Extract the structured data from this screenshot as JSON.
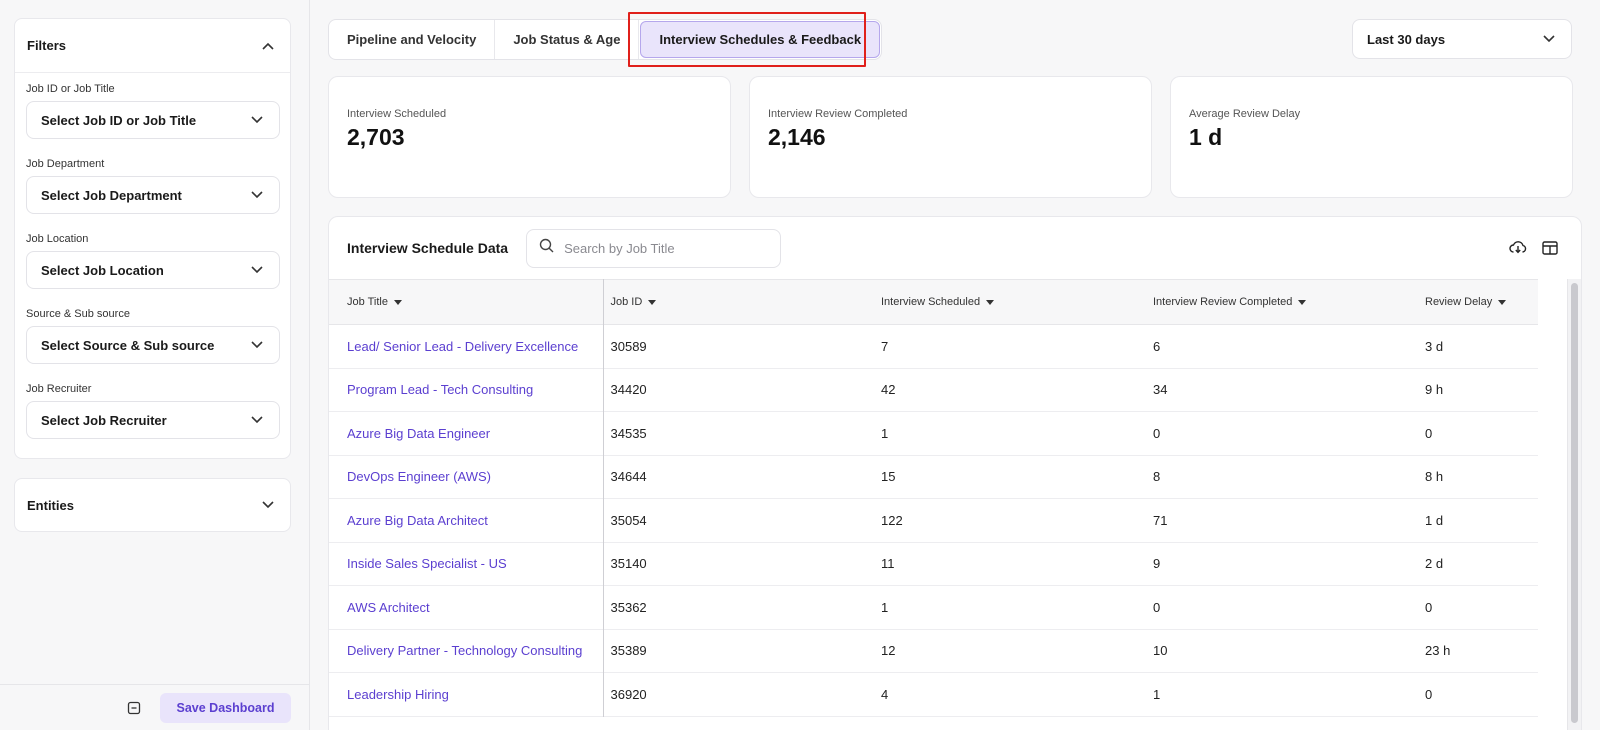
{
  "sidebar": {
    "filters_title": "Filters",
    "filters": [
      {
        "label": "Job ID or Job Title",
        "value": "Select Job ID or Job Title"
      },
      {
        "label": "Job Department",
        "value": "Select Job Department"
      },
      {
        "label": "Job Location",
        "value": "Select Job Location"
      },
      {
        "label": "Source & Sub source",
        "value": "Select Source & Sub source"
      },
      {
        "label": "Job Recruiter",
        "value": "Select Job Recruiter"
      }
    ],
    "entities_title": "Entities",
    "save_label": "Save Dashboard"
  },
  "tabs": [
    "Pipeline and Velocity",
    "Job Status & Age",
    "Interview Schedules & Feedback"
  ],
  "active_tab": "Interview Schedules & Feedback",
  "range": {
    "value": "Last 30 days"
  },
  "kpis": [
    {
      "label": "Interview Scheduled",
      "value": "2,703"
    },
    {
      "label": "Interview Review Completed",
      "value": "2,146"
    },
    {
      "label": "Average Review Delay",
      "value": "1 d"
    }
  ],
  "table": {
    "title": "Interview Schedule Data",
    "search_placeholder": "Search by Job Title",
    "columns": [
      "Job Title",
      "Job ID",
      "Interview Scheduled",
      "Interview Review Completed",
      "Review Delay"
    ],
    "rows": [
      [
        "Lead/ Senior Lead - Delivery Excellence",
        "30589",
        "7",
        "6",
        "3 d"
      ],
      [
        "Program Lead - Tech Consulting",
        "34420",
        "42",
        "34",
        "9 h"
      ],
      [
        "Azure Big Data Engineer",
        "34535",
        "1",
        "0",
        "0"
      ],
      [
        "DevOps Engineer (AWS)",
        "34644",
        "15",
        "8",
        "8 h"
      ],
      [
        "Azure Big Data Architect",
        "35054",
        "122",
        "71",
        "1 d"
      ],
      [
        "Inside Sales Specialist - US",
        "35140",
        "11",
        "9",
        "2 d"
      ],
      [
        "AWS Architect",
        "35362",
        "1",
        "0",
        "0"
      ],
      [
        "Delivery Partner - Technology Consulting",
        "35389",
        "12",
        "10",
        "23 h"
      ],
      [
        "Leadership Hiring",
        "36920",
        "4",
        "1",
        "0"
      ]
    ]
  },
  "colors": {
    "accent": "#5b3fd0",
    "active_tab_bg": "#e9e4fb",
    "highlight": "#e0201b"
  },
  "icons": [
    "chevron-up-icon",
    "chevron-down-icon",
    "collapse-icon",
    "search-icon",
    "download-cloud-icon",
    "table-columns-icon"
  ]
}
